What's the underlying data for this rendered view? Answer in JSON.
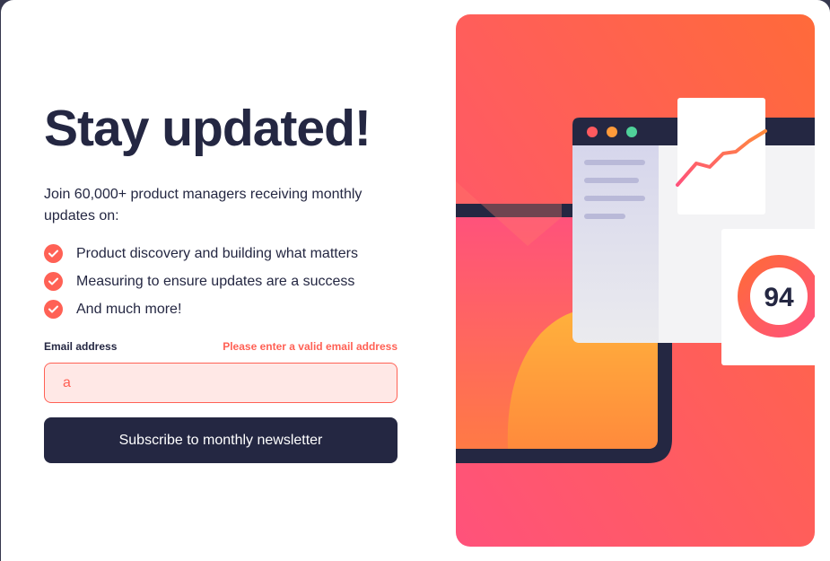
{
  "signup": {
    "title": "Stay updated!",
    "intro": "Join 60,000+ product managers receiving monthly updates on:",
    "benefits": [
      "Product discovery and building what matters",
      "Measuring to ensure updates are a success",
      "And much more!"
    ],
    "email_label": "Email address",
    "email_error": "Please enter a valid email address",
    "email_value": "a",
    "subscribe_label": "Subscribe to monthly newsletter"
  },
  "illustration": {
    "score": "94"
  },
  "colors": {
    "dark_navy": "#242742",
    "tomato": "#ff6155",
    "error_bg": "#ffe8e6",
    "gradient_pink": "#ff527b",
    "gradient_orange": "#ff6a3a"
  },
  "icons": {
    "benefit": "check-circle-icon"
  }
}
